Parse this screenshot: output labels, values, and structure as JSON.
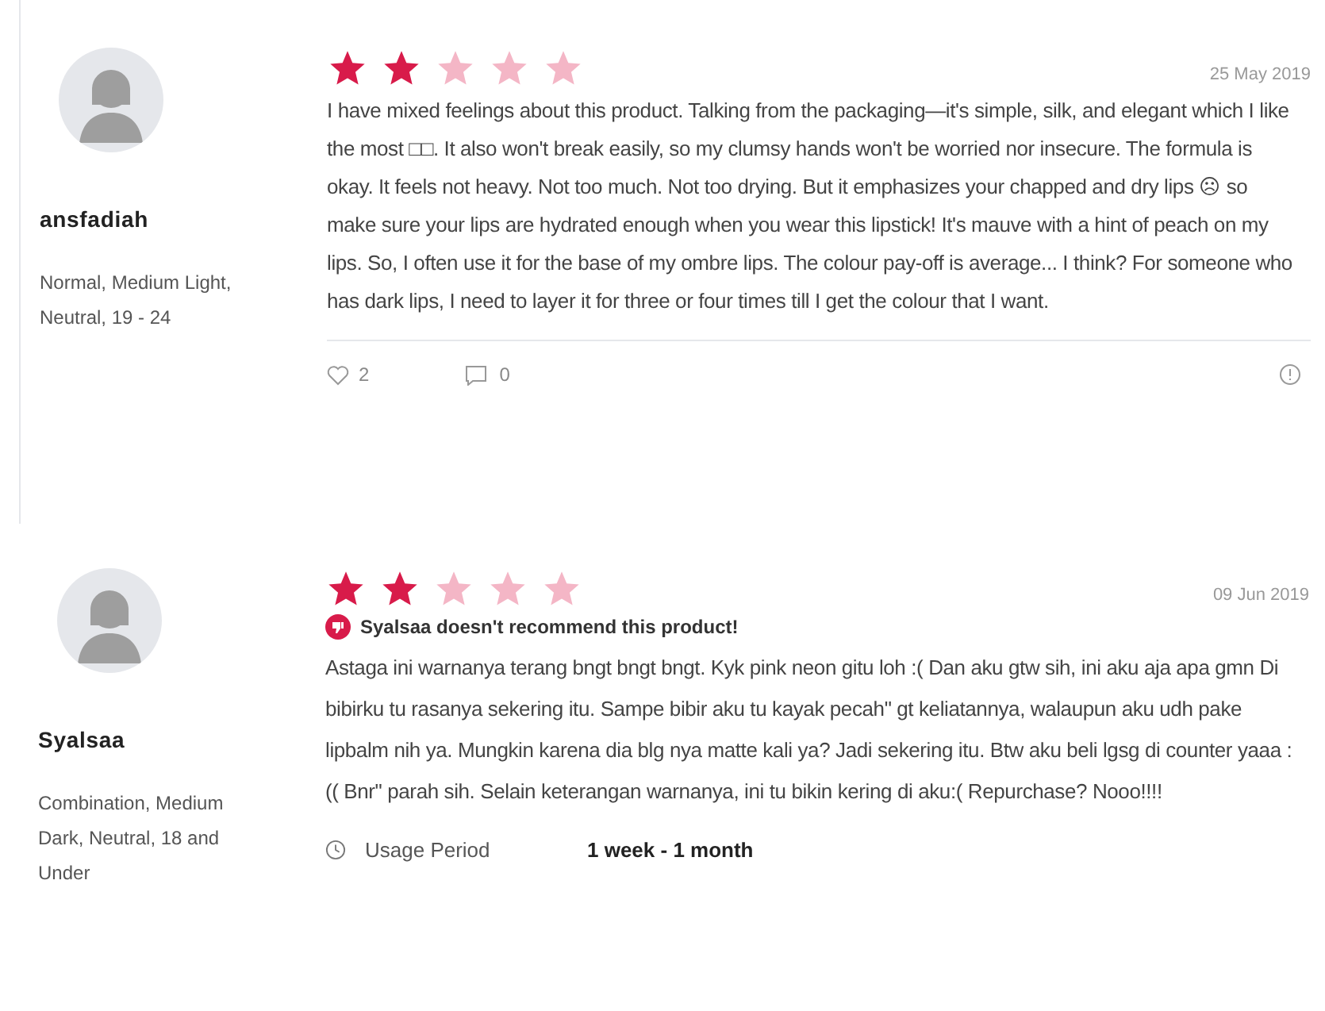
{
  "reviews": [
    {
      "username": "ansfadiah",
      "profile": "Normal, Medium Light, Neutral, 19 - 24",
      "stars": 2,
      "date": "25 May 2019",
      "text": "I have mixed feelings about this product. Talking from the packaging—it's simple, silk, and elegant which I like the most □□. It also won't break easily, so my clumsy hands won't be worried nor insecure. The formula is okay. It feels not heavy. Not too much. Not too drying. But it emphasizes your chapped and dry lips ☹ so make sure your lips are hydrated enough when you wear this lipstick! It's mauve with a hint of peach on my lips. So, I often use it for the base of my ombre lips. The colour pay-off is average... I think? For someone who has dark lips, I need to layer it for three or four times till I get the colour that I want.",
      "likes": "2",
      "comments": "0"
    },
    {
      "username": "Syalsaa",
      "profile": "Combination, Medium Dark, Neutral, 18 and Under",
      "stars": 2,
      "date": "09 Jun 2019",
      "not_recommend": "Syalsaa doesn't recommend this product!",
      "text": "Astaga ini warnanya terang bngt bngt bngt. Kyk pink neon gitu loh :( Dan aku gtw sih, ini aku aja apa gmn Di bibirku tu rasanya sekering itu. Sampe bibir aku tu kayak pecah\" gt keliatannya, walaupun aku udh pake lipbalm nih ya. Mungkin karena dia blg nya matte kali ya? Jadi sekering itu. Btw aku beli lgsg di counter yaaa :(( Bnr\" parah sih. Selain keterangan warnanya, ini tu bikin kering di aku:( Repurchase? Nooo!!!!",
      "usage_label": "Usage Period",
      "usage_value": "1 week - 1 month"
    }
  ]
}
